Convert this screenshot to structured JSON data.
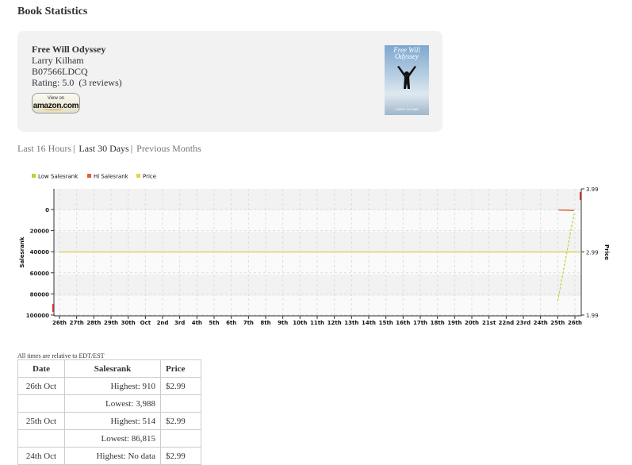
{
  "page": {
    "title": "Book Statistics"
  },
  "book": {
    "title": "Free Will Odyssey",
    "author": "Larry Kilham",
    "asin": "B07566LDCQ",
    "rating": "Rating: 5.0  (3 reviews)",
    "amazon_button": {
      "line1": "View on",
      "line2": "amazon.com"
    },
    "cover": {
      "title": "Free Will Odyssey",
      "author": "LARRY KILHAM"
    }
  },
  "range_nav": [
    {
      "label": "Last 16 Hours",
      "active": false
    },
    {
      "label": "Last 30 Days",
      "active": true
    },
    {
      "label": "Previous Months",
      "active": false
    }
  ],
  "chart_data": {
    "type": "line",
    "legend": [
      {
        "name": "Low Salesrank",
        "color": "#b8d432"
      },
      {
        "name": "Hi Salesrank",
        "color": "#e06030"
      },
      {
        "name": "Price",
        "color": "#e8d048"
      }
    ],
    "legend_position": "top-left",
    "x_labels": [
      "26th",
      "27th",
      "28th",
      "29th",
      "30th",
      "Oct",
      "2nd",
      "3rd",
      "4th",
      "5th",
      "6th",
      "7th",
      "8th",
      "9th",
      "10th",
      "11th",
      "12th",
      "13th",
      "14th",
      "15th",
      "16th",
      "17th",
      "18th",
      "19th",
      "20th",
      "21st",
      "22nd",
      "23rd",
      "24th",
      "25th",
      "26th"
    ],
    "y_left": {
      "label": "Salesrank",
      "ticks": [
        "0",
        "20000",
        "40000",
        "60000",
        "80000",
        "100000"
      ],
      "min": 0,
      "max": 100000,
      "inverted": true
    },
    "y_right": {
      "label": "Price",
      "ticks": [
        "3.99",
        "2.99",
        "1.99"
      ],
      "min": 1.99,
      "max": 3.99
    },
    "grid": true,
    "series": [
      {
        "name": "Low Salesrank",
        "values_by_index": [
          [
            29.0,
            86815
          ],
          [
            29.95,
            3988
          ]
        ]
      },
      {
        "name": "Hi Salesrank",
        "values_by_index": [
          [
            29.0,
            514
          ],
          [
            29.95,
            910
          ]
        ]
      },
      {
        "name": "Price",
        "values_by_index": [
          [
            0,
            2.99
          ],
          [
            30,
            2.99
          ]
        ]
      }
    ]
  },
  "table": {
    "note": "All times are relative to EDT/EST",
    "headers": [
      "Date",
      "Salesrank",
      "Price"
    ],
    "rows": [
      {
        "date": "26th Oct",
        "rank": "Highest: 910",
        "price": "$2.99"
      },
      {
        "date": "",
        "rank": "Lowest: 3,988",
        "price": ""
      },
      {
        "date": "25th Oct",
        "rank": "Highest: 514",
        "price": "$2.99"
      },
      {
        "date": "",
        "rank": "Lowest: 86,815",
        "price": ""
      },
      {
        "date": "24th Oct",
        "rank": "Highest: No data",
        "price": "$2.99"
      }
    ]
  }
}
